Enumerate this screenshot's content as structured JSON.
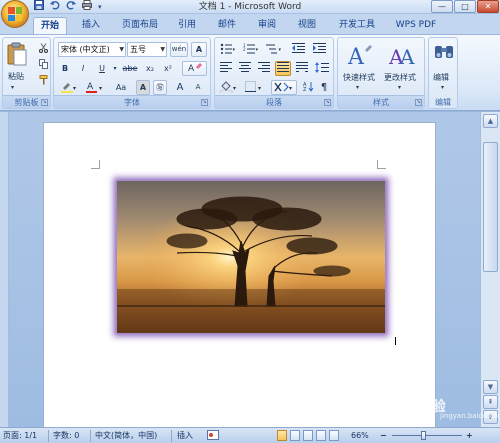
{
  "window": {
    "title": "文档 1 - Microsoft Word",
    "controls": [
      "—",
      "□",
      "✕"
    ]
  },
  "quick_access": [
    "save-icon",
    "undo-icon",
    "redo-icon",
    "print-icon"
  ],
  "tabs": [
    {
      "label": "开始",
      "active": true
    },
    {
      "label": "插入"
    },
    {
      "label": "页面布局"
    },
    {
      "label": "引用"
    },
    {
      "label": "邮件"
    },
    {
      "label": "审阅"
    },
    {
      "label": "视图"
    },
    {
      "label": "开发工具"
    },
    {
      "label": "WPS PDF"
    }
  ],
  "ribbon": {
    "clipboard": {
      "paste": "粘贴",
      "label": "剪贴板"
    },
    "font": {
      "family": "宋体 (中文正)",
      "size": "五号",
      "buttons": [
        "B",
        "I",
        "U",
        "abe",
        "x₂",
        "x²",
        "Aa",
        "A",
        "A",
        "A"
      ],
      "size_grow": "A",
      "size_shrink": "A",
      "label": "字体"
    },
    "paragraph": {
      "label": "段落"
    },
    "styles": {
      "quick": "快速样式",
      "change": "更改样式",
      "label": "样式"
    },
    "editing": {
      "label": "编辑"
    }
  },
  "statusbar": {
    "page": "页面: 1/1",
    "words": "字数: 0",
    "language": "中文(简体，中国)",
    "mode": "插入",
    "zoom": "66%",
    "zoom_minus": "−",
    "zoom_plus": "+"
  },
  "watermark": {
    "text": "Bai 经验",
    "url": "jingyan.baidu.com"
  },
  "colors": {
    "ribbon_bg": "#dde9f8",
    "accent": "#15428b",
    "photo_glow": "#a486c9",
    "highlight": "#f7e64a",
    "font_color": "#e02020"
  }
}
